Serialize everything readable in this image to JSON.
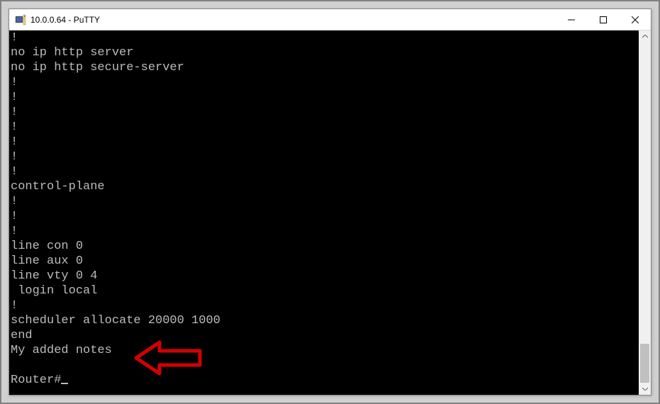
{
  "window": {
    "title": "10.0.0.64 - PuTTY"
  },
  "terminal": {
    "lines": [
      "!",
      "no ip http server",
      "no ip http secure-server",
      "!",
      "!",
      "!",
      "!",
      "!",
      "!",
      "!",
      "control-plane",
      "!",
      "!",
      "!",
      "line con 0",
      "line aux 0",
      "line vty 0 4",
      " login local",
      "!",
      "scheduler allocate 20000 1000",
      "end",
      "My added notes",
      "",
      "Router#"
    ],
    "prompt": "Router#"
  },
  "annotation": {
    "type": "arrow-left",
    "color": "#d40000",
    "target_text": "My added notes"
  }
}
